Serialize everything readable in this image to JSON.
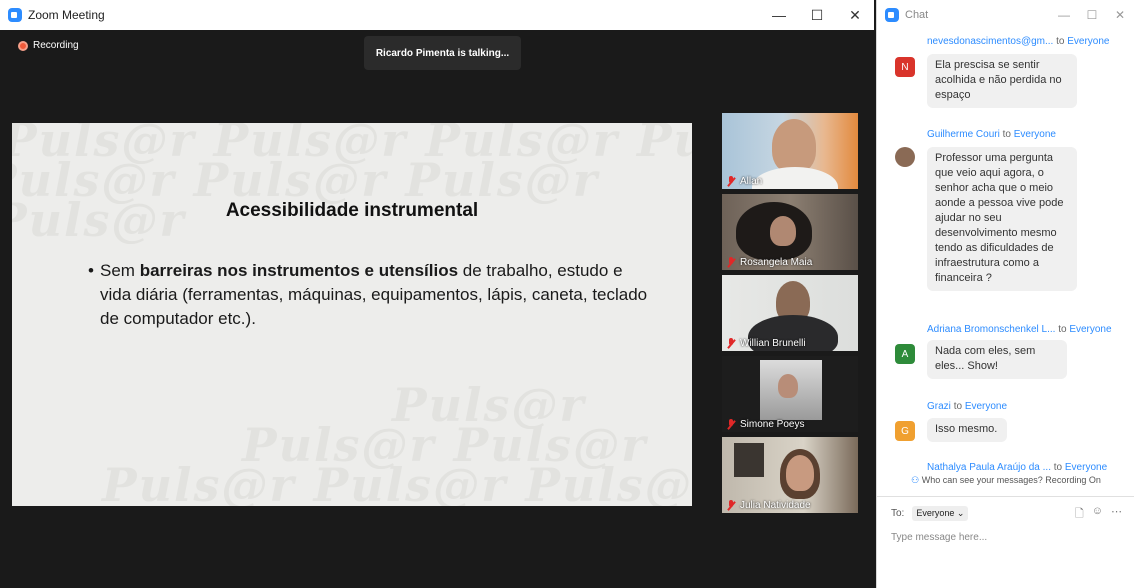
{
  "meeting": {
    "window_title": "Zoom Meeting",
    "controls": {
      "minimize": "—",
      "maximize": "☐",
      "close": "✕"
    },
    "recording_label": "Recording",
    "talking_banner": "Ricardo Pimenta is talking...",
    "slide": {
      "watermark": "Puls@r",
      "title": "Acessibilidade instrumental",
      "bullet_symbol": "•",
      "bullet_prefix": "Sem ",
      "bullet_bold": "barreiras nos instrumentos e utensílios",
      "bullet_rest": " de trabalho, estudo e vida diária (ferramentas, máquinas, equipamentos, lápis, caneta, teclado de computador etc.)."
    },
    "participants": [
      {
        "name": "Allan"
      },
      {
        "name": "Rosangela Maia"
      },
      {
        "name": "Willian Brunelli"
      },
      {
        "name": "Simone Poeys"
      },
      {
        "name": "Julia Natividade"
      }
    ]
  },
  "chat": {
    "window_title": "Chat",
    "controls": {
      "minimize": "—",
      "maximize": "☐",
      "close": "✕"
    },
    "to_word": "to",
    "messages": [
      {
        "avatar_letter": "N",
        "avatar_color": "#d9342b",
        "sender": "nevesdonascimentos@gm...",
        "target": "Everyone",
        "text": "Ela prescisa se sentir acolhida e não perdida no espaço"
      },
      {
        "avatar_letter": "",
        "avatar_color": "#8a6a55",
        "sender": "Guilherme Couri",
        "target": "Everyone",
        "text": "Professor uma pergunta que veio aqui agora, o senhor acha que o meio aonde a pessoa vive pode ajudar no seu desenvolvimento mesmo tendo as dificuldades de infraestrutura como a financeira ?"
      },
      {
        "avatar_letter": "A",
        "avatar_color": "#2e8b3a",
        "sender": "Adriana Bromonschenkel L...",
        "target": "Everyone",
        "text": "Nada com eles, sem eles... Show!"
      },
      {
        "avatar_letter": "G",
        "avatar_color": "#f0a030",
        "sender": "Grazi",
        "target": "Everyone",
        "text": "Isso mesmo."
      },
      {
        "avatar_letter": "",
        "avatar_color": "#888888",
        "sender": "Nathalya Paula Araújo da ...",
        "target": "Everyone",
        "text": ""
      }
    ],
    "privacy_note": "Who can see your messages? Recording On",
    "to_label": "To:",
    "recipient": "Everyone",
    "input_placeholder": "Type message here...",
    "accent_color": "#2d8cff"
  }
}
